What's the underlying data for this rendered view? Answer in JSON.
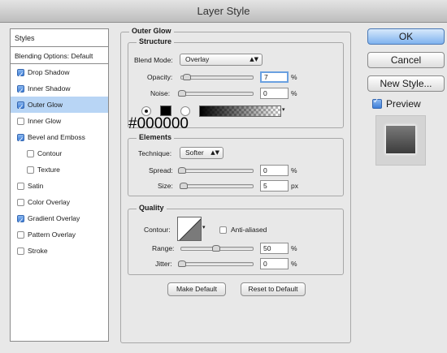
{
  "window": {
    "title": "Layer Style"
  },
  "styles_panel": {
    "header": "Styles",
    "blending_options": "Blending Options: Default",
    "items": [
      {
        "label": "Drop Shadow",
        "checked": true
      },
      {
        "label": "Inner Shadow",
        "checked": true
      },
      {
        "label": "Outer Glow",
        "checked": true,
        "selected": true
      },
      {
        "label": "Inner Glow",
        "checked": false
      },
      {
        "label": "Bevel and Emboss",
        "checked": true
      },
      {
        "label": "Contour",
        "checked": false,
        "indent": true
      },
      {
        "label": "Texture",
        "checked": false,
        "indent": true
      },
      {
        "label": "Satin",
        "checked": false
      },
      {
        "label": "Color Overlay",
        "checked": false
      },
      {
        "label": "Gradient Overlay",
        "checked": true
      },
      {
        "label": "Pattern Overlay",
        "checked": false
      },
      {
        "label": "Stroke",
        "checked": false
      }
    ]
  },
  "outer_glow": {
    "title": "Outer Glow",
    "structure": {
      "title": "Structure",
      "blend_mode_label": "Blend Mode:",
      "blend_mode_value": "Overlay",
      "opacity_label": "Opacity:",
      "opacity_value": "7",
      "opacity_unit": "%",
      "noise_label": "Noise:",
      "noise_value": "0",
      "noise_unit": "%",
      "color_hex": "#000000",
      "opacity_slider_level": 0.07,
      "noise_slider_level": 0.0
    },
    "elements": {
      "title": "Elements",
      "technique_label": "Technique:",
      "technique_value": "Softer",
      "spread_label": "Spread:",
      "spread_value": "0",
      "spread_unit": "%",
      "size_label": "Size:",
      "size_value": "5",
      "size_unit": "px",
      "spread_slider_level": 0.0,
      "size_slider_level": 0.02
    },
    "quality": {
      "title": "Quality",
      "contour_label": "Contour:",
      "anti_aliased_label": "Anti-aliased",
      "anti_aliased_checked": false,
      "range_label": "Range:",
      "range_value": "50",
      "range_unit": "%",
      "jitter_label": "Jitter:",
      "jitter_value": "0",
      "jitter_unit": "%",
      "range_slider_level": 0.5,
      "jitter_slider_level": 0.0
    },
    "make_default_label": "Make Default",
    "reset_default_label": "Reset to Default"
  },
  "buttons": {
    "ok": "OK",
    "cancel": "Cancel",
    "new_style": "New Style...",
    "preview_label": "Preview",
    "preview_checked": true
  },
  "colors": {
    "accent": "#7fb2ef",
    "selected_row": "#b8d5f5",
    "glow_color": "#000000"
  }
}
